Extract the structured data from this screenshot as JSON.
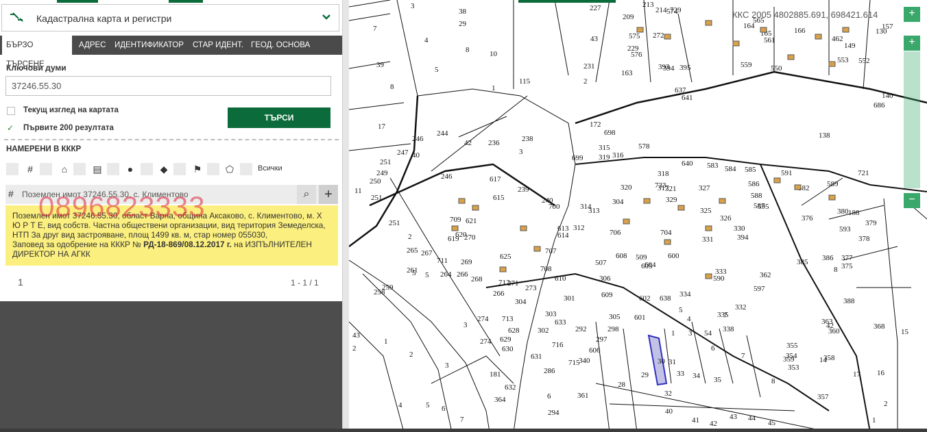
{
  "panel": {
    "title": "Кадастрална карта и регистри",
    "tabs": [
      "БЪРЗО ТЪРСЕНЕ",
      "АДРЕС",
      "ИДЕНТИФИКАТОР",
      "СТАР ИДЕНТ.",
      "ГЕОД. ОСНОВА"
    ],
    "keywords_label": "Ключови думи",
    "keywords_value": "37246.55.30",
    "current_view_label": "Текущ изглед на картата",
    "first200_label": "Първите 200 резултата",
    "search_button": "ТЪРСИ",
    "found_label": "НАМЕРЕНИ В КККР",
    "filter_all": "Всички",
    "result_title": "Поземлен имот 37246.55.30, с. Климентово",
    "watermark": "0896823333",
    "info_text": "Поземлен имот 37246.55.30, област Варна, община Аксаково, с. Климентово, м. Х Ю Р Т Е, вид собств. Частна обществени организации, вид територия Земеделска, НТП За друг вид застрояване, площ 1499 кв. м, стар номер 055030,",
    "info_order_prefix": "Заповед за одобрение на КККР № ",
    "info_order_bold": "РД-18-869/08.12.2017 г.",
    "info_order_suffix": " на ИЗПЪЛНИТЕЛЕН ДИРЕКТОР НА АГКК",
    "page_number": "1",
    "page_count": "1 - 1 / 1"
  },
  "map": {
    "coordinates": "ККС 2005 4802885.691, 698421.614",
    "zoom_in": "+",
    "zoom_out": "−",
    "labels": [
      {
        "t": "3"
      },
      {
        "t": "38"
      },
      {
        "t": "7"
      },
      {
        "t": "29"
      },
      {
        "t": "4"
      },
      {
        "t": "8"
      },
      {
        "t": "10"
      },
      {
        "t": "39"
      },
      {
        "t": "5"
      },
      {
        "t": "8"
      },
      {
        "t": "115"
      },
      {
        "t": "1"
      },
      {
        "t": "227"
      },
      {
        "t": "209"
      },
      {
        "t": "43"
      },
      {
        "t": "2"
      },
      {
        "t": "231"
      },
      {
        "t": "163"
      },
      {
        "t": "637"
      },
      {
        "t": "641"
      },
      {
        "t": "17"
      },
      {
        "t": "246"
      },
      {
        "t": "247"
      },
      {
        "t": "40"
      },
      {
        "t": "244"
      },
      {
        "t": "238"
      },
      {
        "t": "3"
      },
      {
        "t": "236"
      },
      {
        "t": "42"
      },
      {
        "t": "172"
      },
      {
        "t": "698"
      },
      {
        "t": "699"
      },
      {
        "t": "578"
      },
      {
        "t": "640"
      },
      {
        "t": "583"
      },
      {
        "t": "138"
      },
      {
        "t": "721"
      },
      {
        "t": "251"
      },
      {
        "t": "249"
      },
      {
        "t": "250"
      },
      {
        "t": "11"
      },
      {
        "t": "251"
      },
      {
        "t": "246"
      },
      {
        "t": "617"
      },
      {
        "t": "615"
      },
      {
        "t": "239"
      },
      {
        "t": "240"
      },
      {
        "t": "700"
      },
      {
        "t": "314"
      },
      {
        "t": "313"
      },
      {
        "t": "304"
      },
      {
        "t": "321"
      },
      {
        "t": "329"
      },
      {
        "t": "330"
      },
      {
        "t": "376"
      },
      {
        "t": "380"
      },
      {
        "t": "188"
      },
      {
        "t": "379"
      },
      {
        "t": "378"
      },
      {
        "t": "251"
      },
      {
        "t": "2"
      },
      {
        "t": "709"
      },
      {
        "t": "621"
      },
      {
        "t": "620"
      },
      {
        "t": "619"
      },
      {
        "t": "270"
      },
      {
        "t": "614"
      },
      {
        "t": "613"
      },
      {
        "t": "312"
      },
      {
        "t": "706"
      },
      {
        "t": "704"
      },
      {
        "t": "331"
      },
      {
        "t": "394"
      },
      {
        "t": "385"
      },
      {
        "t": "386"
      },
      {
        "t": "377"
      },
      {
        "t": "375"
      },
      {
        "t": "265"
      },
      {
        "t": "267"
      },
      {
        "t": "711"
      },
      {
        "t": "269"
      },
      {
        "t": "625"
      },
      {
        "t": "707"
      },
      {
        "t": "708"
      },
      {
        "t": "507"
      },
      {
        "t": "608"
      },
      {
        "t": "509"
      },
      {
        "t": "605"
      },
      {
        "t": "604"
      },
      {
        "t": "600"
      },
      {
        "t": "333"
      },
      {
        "t": "362"
      },
      {
        "t": "8"
      },
      {
        "t": "5"
      },
      {
        "t": "261"
      },
      {
        "t": "5"
      },
      {
        "t": "264"
      },
      {
        "t": "266"
      },
      {
        "t": "268"
      },
      {
        "t": "712"
      },
      {
        "t": "271"
      },
      {
        "t": "273"
      },
      {
        "t": "610"
      },
      {
        "t": "306"
      },
      {
        "t": "638"
      },
      {
        "t": "590"
      },
      {
        "t": "597"
      },
      {
        "t": "259"
      },
      {
        "t": "258"
      },
      {
        "t": "266"
      },
      {
        "t": "304"
      },
      {
        "t": "301"
      },
      {
        "t": "609"
      },
      {
        "t": "602"
      },
      {
        "t": "3"
      },
      {
        "t": "334"
      },
      {
        "t": "332"
      },
      {
        "t": "335"
      },
      {
        "t": "7"
      },
      {
        "t": "388"
      },
      {
        "t": "274"
      },
      {
        "t": "713"
      },
      {
        "t": "303"
      },
      {
        "t": "633"
      },
      {
        "t": "305"
      },
      {
        "t": "601"
      },
      {
        "t": "4"
      },
      {
        "t": "5"
      },
      {
        "t": "363"
      },
      {
        "t": "368"
      },
      {
        "t": "15"
      },
      {
        "t": "43"
      },
      {
        "t": "1"
      },
      {
        "t": "628"
      },
      {
        "t": "629"
      },
      {
        "t": "302"
      },
      {
        "t": "292"
      },
      {
        "t": "298"
      },
      {
        "t": "297"
      },
      {
        "t": "2"
      },
      {
        "t": "1"
      },
      {
        "t": "3"
      },
      {
        "t": "54"
      },
      {
        "t": "338"
      },
      {
        "t": "6"
      },
      {
        "t": "360"
      },
      {
        "t": "14"
      },
      {
        "t": "42"
      },
      {
        "t": "2"
      },
      {
        "t": "274"
      },
      {
        "t": "630"
      },
      {
        "t": "716"
      },
      {
        "t": "606"
      },
      {
        "t": "340"
      },
      {
        "t": "631"
      },
      {
        "t": "715"
      },
      {
        "t": "355"
      },
      {
        "t": "354"
      },
      {
        "t": "359"
      },
      {
        "t": "358"
      },
      {
        "t": "30"
      },
      {
        "t": "31"
      },
      {
        "t": "7"
      },
      {
        "t": "3"
      },
      {
        "t": "181"
      },
      {
        "t": "286"
      },
      {
        "t": "29"
      },
      {
        "t": "33"
      },
      {
        "t": "34"
      },
      {
        "t": "35"
      },
      {
        "t": "8"
      },
      {
        "t": "353"
      },
      {
        "t": "17"
      },
      {
        "t": "16"
      },
      {
        "t": "364"
      },
      {
        "t": "632"
      },
      {
        "t": "6"
      },
      {
        "t": "361"
      },
      {
        "t": "28"
      },
      {
        "t": "32"
      },
      {
        "t": "357"
      },
      {
        "t": "2"
      },
      {
        "t": "4"
      },
      {
        "t": "5"
      },
      {
        "t": "6"
      },
      {
        "t": "7"
      },
      {
        "t": "294"
      },
      {
        "t": "40"
      },
      {
        "t": "41"
      },
      {
        "t": "42"
      },
      {
        "t": "43"
      },
      {
        "t": "44"
      },
      {
        "t": "45"
      },
      {
        "t": "1"
      },
      {
        "t": "591"
      },
      {
        "t": "582"
      },
      {
        "t": "589"
      },
      {
        "t": "593"
      },
      {
        "t": "595"
      },
      {
        "t": "588"
      },
      {
        "t": "587"
      },
      {
        "t": "586"
      },
      {
        "t": "585"
      },
      {
        "t": "584"
      },
      {
        "t": "327"
      },
      {
        "t": "325"
      },
      {
        "t": "326"
      },
      {
        "t": "318"
      },
      {
        "t": "317"
      },
      {
        "t": "316"
      },
      {
        "t": "315"
      },
      {
        "t": "319"
      },
      {
        "t": "320"
      },
      {
        "t": "733"
      },
      {
        "t": "729"
      },
      {
        "t": "565"
      },
      {
        "t": "561"
      },
      {
        "t": "559"
      },
      {
        "t": "550"
      },
      {
        "t": "553"
      },
      {
        "t": "552"
      },
      {
        "t": "149"
      },
      {
        "t": "157"
      },
      {
        "t": "166"
      },
      {
        "t": "165"
      },
      {
        "t": "164"
      },
      {
        "t": "229"
      },
      {
        "t": "272"
      },
      {
        "t": "574"
      },
      {
        "t": "575"
      },
      {
        "t": "576"
      },
      {
        "t": "393"
      },
      {
        "t": "394"
      },
      {
        "t": "395"
      },
      {
        "t": "130"
      },
      {
        "t": "140"
      },
      {
        "t": "686"
      },
      {
        "t": "213"
      },
      {
        "t": "214"
      },
      {
        "t": "462"
      }
    ]
  }
}
